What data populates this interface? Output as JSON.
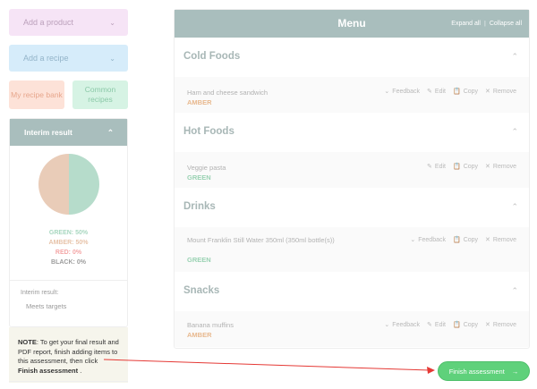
{
  "sidebar": {
    "add_product": "Add a product",
    "add_recipe": "Add a recipe",
    "recipe_bank": "My recipe bank",
    "common_recipes": "Common recipes"
  },
  "interim": {
    "title": "Interim result",
    "green": "GREEN: 50%",
    "amber": "AMBER: 50%",
    "red": "RED: 0%",
    "black": "BLACK: 0%",
    "result_label": "Interim result:",
    "result_value": "Meets targets",
    "pie": {
      "green": 50,
      "amber": 50,
      "colors": {
        "green": "#b6dccb",
        "amber": "#e9ccb8"
      }
    }
  },
  "note": {
    "label": "NOTE",
    "text": ": To get your final result and PDF report, finish adding items to this assessment, then click ",
    "bold_action": "Finish assessment",
    "tail": " ."
  },
  "menu": {
    "title": "Menu",
    "expand_all": "Expand all",
    "sep": "|",
    "collapse_all": "Collapse all",
    "sections": [
      {
        "title": "Cold Foods",
        "items": [
          {
            "name": "Ham and cheese sandwich",
            "rating": "AMBER"
          }
        ]
      },
      {
        "title": "Hot Foods",
        "items": [
          {
            "name": "Veggie pasta",
            "rating": "GREEN"
          }
        ]
      },
      {
        "title": "Drinks",
        "items": [
          {
            "name": "Mount Franklin Still Water 350ml (350ml bottle(s))",
            "rating": "GREEN"
          }
        ]
      },
      {
        "title": "Snacks",
        "items": [
          {
            "name": "Banana muffins",
            "rating": "AMBER"
          }
        ]
      }
    ],
    "actions": {
      "feedback": "Feedback",
      "edit": "Edit",
      "copy": "Copy",
      "remove": "Remove"
    }
  },
  "finish_button": "Finish assessment"
}
